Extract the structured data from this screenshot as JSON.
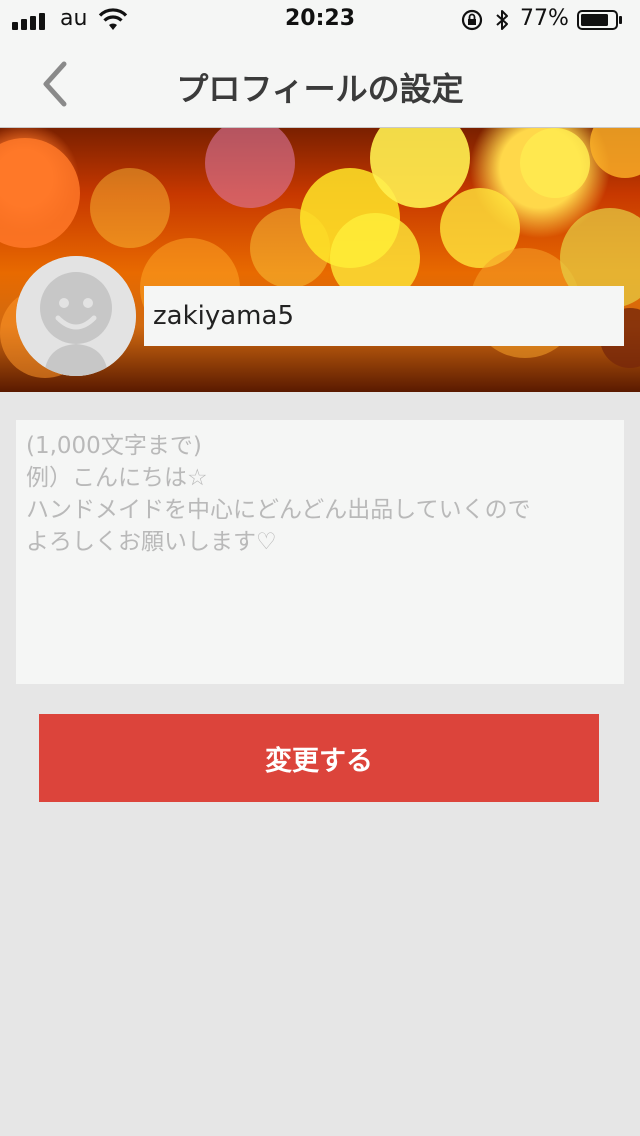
{
  "status_bar": {
    "carrier": "au",
    "time": "20:23",
    "battery_percent": "77%",
    "icons": [
      "signal-icon",
      "wifi-icon",
      "rotation-lock-icon",
      "bluetooth-icon",
      "battery-icon"
    ]
  },
  "nav": {
    "title": "プロフィールの設定",
    "back_icon": "chevron-left-icon"
  },
  "profile": {
    "avatar_icon": "default-avatar-icon",
    "username": "zakiyama5",
    "bio_value": "",
    "bio_placeholder": "(1,000文字まで)\n例）こんにちは☆\nハンドメイドを中心にどんどん出品していくので\nよろしくお願いします♡"
  },
  "actions": {
    "submit_label": "変更する"
  },
  "colors": {
    "accent": "#dc443b",
    "nav_background": "#f5f6f5",
    "page_background": "#e6e6e6"
  }
}
